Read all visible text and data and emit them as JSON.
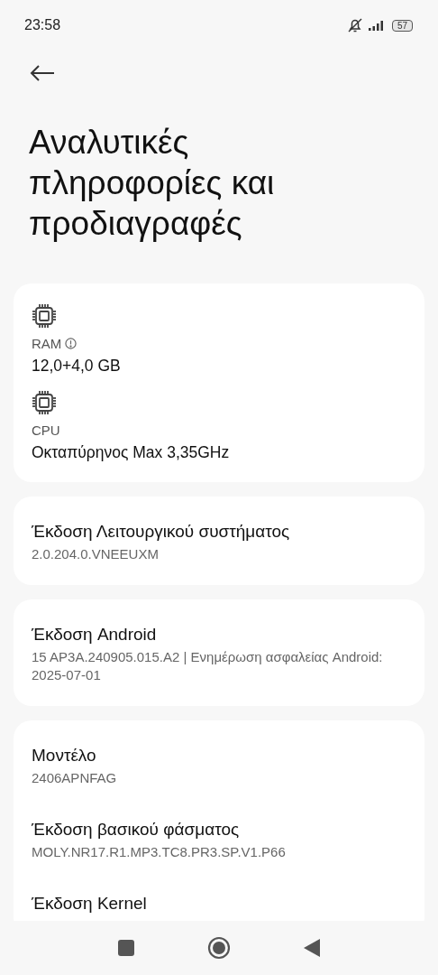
{
  "status_bar": {
    "time": "23:58",
    "battery": "57"
  },
  "title": "Αναλυτικές πληροφορίες και προδιαγραφές",
  "cards": [
    {
      "items": [
        {
          "kind": "spec",
          "label": "RAM",
          "info_icon": true,
          "value": "12,0+4,0 GB"
        },
        {
          "kind": "spec",
          "label": "CPU",
          "info_icon": false,
          "value": "Οκταπύρηνος Max 3,35GHz"
        }
      ]
    },
    {
      "items": [
        {
          "kind": "detail",
          "label": "Έκδοση Λειτουργικού συστήματος",
          "value": "2.0.204.0.VNEEUXM"
        }
      ]
    },
    {
      "items": [
        {
          "kind": "detail",
          "label": "Έκδοση Android",
          "value": "15 AP3A.240905.015.A2 | Ενημέρωση ασφαλείας Android: 2025-07-01"
        }
      ]
    },
    {
      "items": [
        {
          "kind": "detail",
          "label": "Μοντέλο",
          "value": "2406APNFAG"
        },
        {
          "kind": "detail",
          "label": "Έκδοση βασικού φάσματος",
          "value": "MOLY.NR17.R1.MP3.TC8.PR3.SP.V1.P66"
        },
        {
          "kind": "detail",
          "label": "Έκδοση Kernel"
        }
      ]
    }
  ]
}
